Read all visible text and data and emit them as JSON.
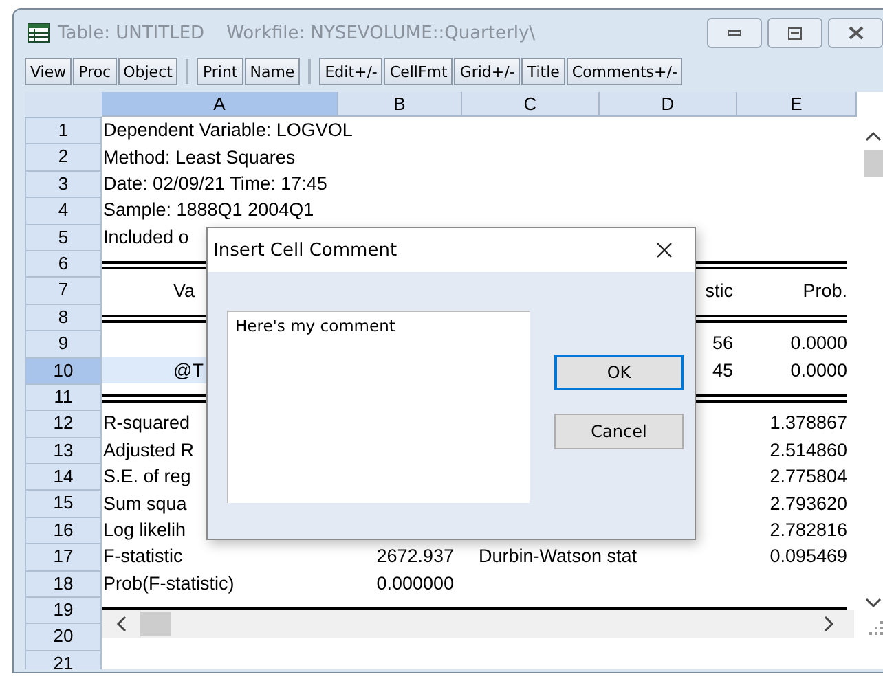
{
  "window": {
    "title": "Table: UNTITLED",
    "subtitle": "Workfile: NYSEVOLUME::Quarterly\\"
  },
  "toolbar": [
    [
      "View",
      "Proc",
      "Object"
    ],
    [
      "Print",
      "Name"
    ],
    [
      "Edit+/-",
      "CellFmt",
      "Grid+/-",
      "Title",
      "Comments+/-"
    ]
  ],
  "columns": [
    {
      "label": "A",
      "selected": true
    },
    {
      "label": "B",
      "selected": false
    },
    {
      "label": "C",
      "selected": false
    },
    {
      "label": "D",
      "selected": false
    },
    {
      "label": "E",
      "selected": false
    }
  ],
  "rows": [
    {
      "number": "1",
      "selected": false,
      "kind": "text",
      "cells": [
        "Dependent Variable: LOGVOL"
      ]
    },
    {
      "number": "2",
      "selected": false,
      "kind": "text",
      "cells": [
        "Method: Least Squares"
      ]
    },
    {
      "number": "3",
      "selected": false,
      "kind": "text",
      "cells": [
        "Date: 02/09/21   Time: 17:45"
      ]
    },
    {
      "number": "4",
      "selected": false,
      "kind": "text",
      "cells": [
        "Sample: 1888Q1 2004Q1"
      ]
    },
    {
      "number": "5",
      "selected": false,
      "kind": "text",
      "cells": [
        "Included o"
      ]
    },
    {
      "number": "6",
      "selected": false,
      "kind": "rule",
      "cells": []
    },
    {
      "number": "7",
      "selected": false,
      "kind": "centered",
      "cells": [
        "Va",
        null,
        null,
        "stic",
        "Prob."
      ]
    },
    {
      "number": "8",
      "selected": false,
      "kind": "rule",
      "cells": []
    },
    {
      "number": "9",
      "selected": false,
      "kind": "centered",
      "cells": [
        null,
        null,
        null,
        "56",
        "0.0000"
      ]
    },
    {
      "number": "10",
      "selected": true,
      "kind": "centered",
      "cells": [
        "@T",
        null,
        null,
        "45",
        "0.0000"
      ]
    },
    {
      "number": "11",
      "selected": false,
      "kind": "rule",
      "cells": []
    },
    {
      "number": "12",
      "selected": false,
      "kind": "text",
      "cells": [
        "R-squared",
        null,
        null,
        null,
        "1.378867"
      ]
    },
    {
      "number": "13",
      "selected": false,
      "kind": "text",
      "cells": [
        "Adjusted R",
        null,
        null,
        null,
        "2.514860"
      ]
    },
    {
      "number": "14",
      "selected": false,
      "kind": "text",
      "cells": [
        "S.E. of reg",
        null,
        null,
        null,
        "2.775804"
      ]
    },
    {
      "number": "15",
      "selected": false,
      "kind": "text",
      "cells": [
        "Sum squa",
        null,
        null,
        null,
        "2.793620"
      ]
    },
    {
      "number": "16",
      "selected": false,
      "kind": "text",
      "cells": [
        "Log likelih",
        null,
        null,
        null,
        "2.782816"
      ]
    },
    {
      "number": "17",
      "selected": false,
      "kind": "text",
      "cells": [
        "F-statistic",
        "2672.937",
        "Durbin-Watson stat",
        null,
        "0.095469"
      ]
    },
    {
      "number": "18",
      "selected": false,
      "kind": "text",
      "cells": [
        "Prob(F-statistic)",
        "0.000000"
      ]
    },
    {
      "number": "19",
      "selected": false,
      "kind": "rule",
      "cells": []
    },
    {
      "number": "20",
      "selected": false,
      "kind": "text",
      "cells": []
    },
    {
      "number": "21",
      "selected": false,
      "kind": "text",
      "cells": []
    }
  ],
  "dialog": {
    "title": "Insert Cell Comment",
    "comment": "Here's my comment",
    "buttons": [
      {
        "label": "OK",
        "default": true
      },
      {
        "label": "Cancel",
        "default": false
      }
    ]
  }
}
